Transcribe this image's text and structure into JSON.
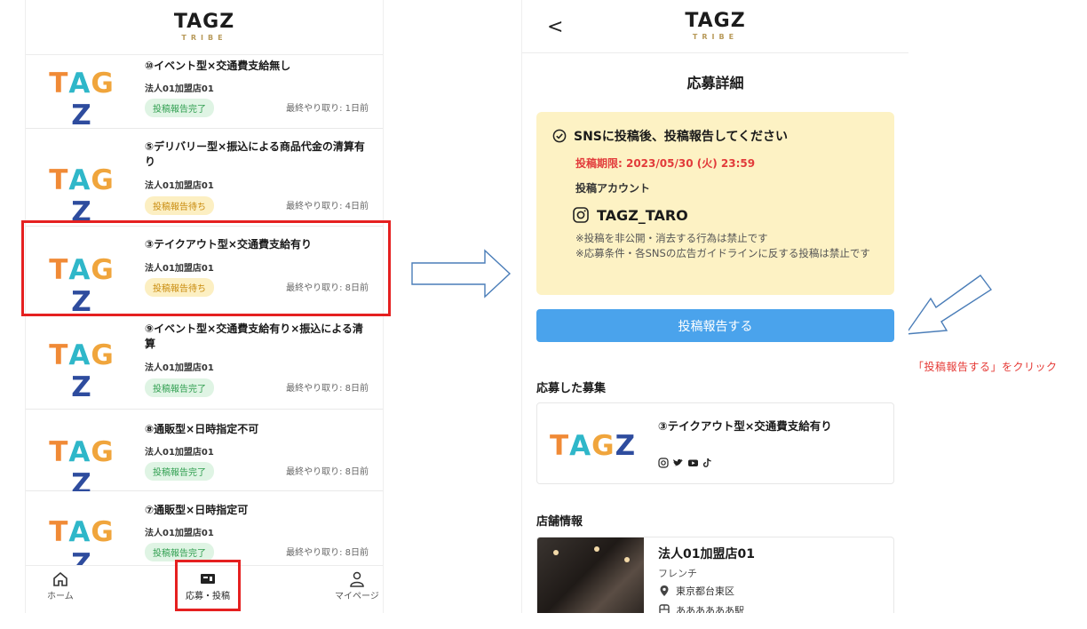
{
  "left": {
    "logo": {
      "main": "TAGZ",
      "sub": "TRIBE"
    },
    "list": [
      {
        "title": "⑩イベント型×交通費支給無し",
        "shop": "法人01加盟店01",
        "status": "投稿報告完了",
        "status_type": "done",
        "last": "最終やり取り: 1日前"
      },
      {
        "title": "⑤デリバリー型×振込による商品代金の清算有り",
        "shop": "法人01加盟店01",
        "status": "投稿報告待ち",
        "status_type": "wait",
        "last": "最終やり取り: 4日前"
      },
      {
        "title": "③テイクアウト型×交通費支給有り",
        "shop": "法人01加盟店01",
        "status": "投稿報告待ち",
        "status_type": "wait",
        "last": "最終やり取り: 8日前"
      },
      {
        "title": "⑨イベント型×交通費支給有り×振込による清算",
        "shop": "法人01加盟店01",
        "status": "投稿報告完了",
        "status_type": "done",
        "last": "最終やり取り: 8日前"
      },
      {
        "title": "⑧通販型×日時指定不可",
        "shop": "法人01加盟店01",
        "status": "投稿報告完了",
        "status_type": "done",
        "last": "最終やり取り: 8日前"
      },
      {
        "title": "⑦通販型×日時指定可",
        "shop": "法人01加盟店01",
        "status": "投稿報告完了",
        "status_type": "done",
        "last": "最終やり取り: 8日前"
      }
    ],
    "nav": {
      "home": "ホーム",
      "apply": "応募・投稿",
      "mypage": "マイページ"
    }
  },
  "right": {
    "back": "<",
    "logo": {
      "main": "TAGZ",
      "sub": "TRIBE"
    },
    "page_title": "応募詳細",
    "notice": {
      "heading": "SNSに投稿後、投稿報告してください",
      "deadline": "投稿期限: 2023/05/30 (火) 23:59",
      "account_label": "投稿アカウント",
      "account": "TAGZ_TARO",
      "note1": "※投稿を非公開・消去する行為は禁止です",
      "note2": "※応募条件・各SNSの広告ガイドラインに反する投稿は禁止です"
    },
    "primary_button": "投稿報告する",
    "applied_section": "応募した募集",
    "applied_title": "③テイクアウト型×交通費支給有り",
    "shop_section": "店舗情報",
    "shop": {
      "name": "法人01加盟店01",
      "genre": "フレンチ",
      "address": "東京都台東区",
      "extra": "ああああああ駅"
    }
  },
  "instruction": "「投稿報告する」をクリック",
  "colors": {
    "red": "#e52020",
    "primary": "#4aa3ec",
    "notice_bg": "#fdf2c4",
    "done_bg": "#dff4e4",
    "wait_bg": "#fcefc2"
  }
}
